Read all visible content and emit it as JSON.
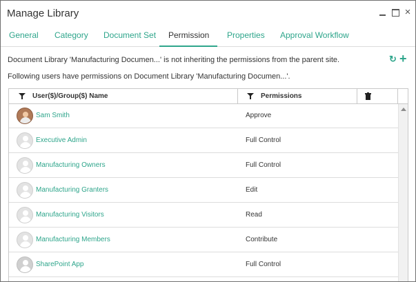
{
  "window": {
    "title": "Manage Library",
    "minimize_icon": "minimize-icon",
    "maximize_icon": "maximize-icon",
    "close_symbol": "×"
  },
  "tabs": [
    {
      "label": "General"
    },
    {
      "label": "Category"
    },
    {
      "label": "Document Set"
    },
    {
      "label": "Permission"
    },
    {
      "label": "Properties"
    },
    {
      "label": "Approval Workflow"
    }
  ],
  "active_tab": "Permission",
  "info": {
    "inherit_message": "Document Library 'Manufacturing Documen...' is not inheriting the permissions from the parent site.",
    "users_message": "Following users have permissions on Document Library 'Manufacturing Documen...'."
  },
  "toolbar": {
    "refresh_glyph": "↻",
    "add_glyph": "+"
  },
  "grid": {
    "columns": [
      {
        "label": "User($)/Group($) Name",
        "filter_icon": "filter-icon"
      },
      {
        "label": "Permissions",
        "filter_icon": "filter-icon"
      },
      {
        "label": "",
        "icon": "trash-icon"
      }
    ],
    "rows": [
      {
        "name": "Sam Smith",
        "permission": "Approve",
        "avatar": "photo"
      },
      {
        "name": "Executive Admin",
        "permission": "Full Control",
        "avatar": "group"
      },
      {
        "name": "Manufacturing Owners",
        "permission": "Full Control",
        "avatar": "group"
      },
      {
        "name": "Manufacturing Granters",
        "permission": "Edit",
        "avatar": "group"
      },
      {
        "name": "Manufacturing Visitors",
        "permission": "Read",
        "avatar": "group"
      },
      {
        "name": "Manufacturing Members",
        "permission": "Contribute",
        "avatar": "group"
      },
      {
        "name": "SharePoint App",
        "permission": "Full Control",
        "avatar": "app"
      }
    ]
  },
  "colors": {
    "accent": "#2ea58b",
    "text": "#333333",
    "border": "#c8c8c8"
  }
}
